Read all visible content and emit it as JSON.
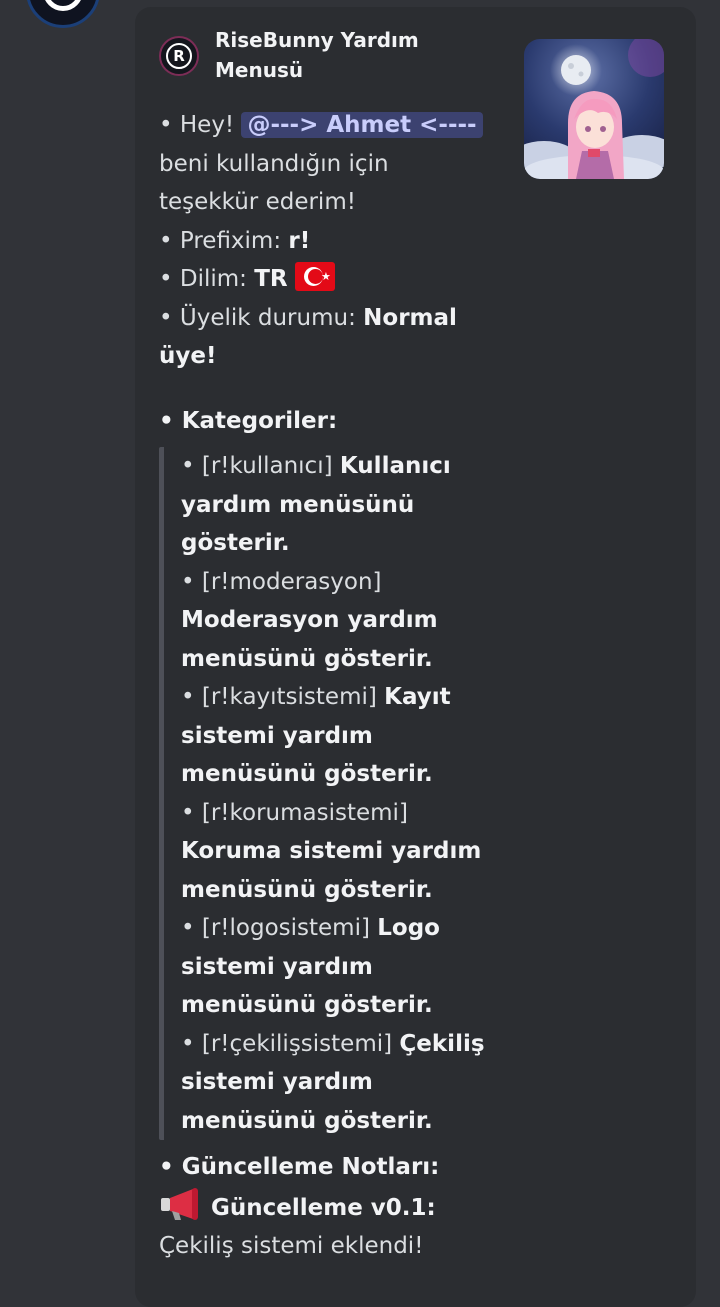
{
  "embed": {
    "author": "RiseBunny  Yardım Menusü",
    "author_icon_letter": "R",
    "intro": {
      "hey": "• Hey! ",
      "mention": "@--->  Ahmet <----",
      "thanks": " beni kullandığın için teşekkür ederim!"
    },
    "prefix": {
      "label": " •  Prefixim: ",
      "value": "r!"
    },
    "language": {
      "label": " • Dilim: ",
      "value": "TR"
    },
    "membership": {
      "label": " • Üyelik durumu: ",
      "value": "Normal üye!"
    },
    "categories_title": "• Kategoriler:",
    "categories": [
      {
        "command": "• [r!kullanıcı] ",
        "description": "Kullanıcı yardım menüsünü gösterir."
      },
      {
        "command": "• [r!moderasyon] ",
        "description": "Moderasyon yardım menüsünü gösterir."
      },
      {
        "command": "• [r!kayıtsistemi] ",
        "description": "Kayıt sistemi yardım menüsünü gösterir."
      },
      {
        "command": "• [r!korumasistemi] ",
        "description": "Koruma sistemi yardım menüsünü gösterir."
      },
      {
        "command": "• [r!logosistemi] ",
        "description": "Logo sistemi yardım menüsünü gösterir."
      },
      {
        "command": "• [r!çekilişsistemi] ",
        "description": "Çekiliş sistemi yardım menüsünü gösterir."
      }
    ],
    "update_title": "• Güncelleme Notları:",
    "update_version": " Güncelleme v0.1:",
    "update_note": "Çekiliş sistemi eklendi!"
  },
  "icons": {
    "top_avatar": "bot-avatar-icon",
    "author_icon": "registered-r-icon",
    "thumbnail": "anime-girl-moon-thumbnail",
    "flag": "turkey-flag-icon",
    "megaphone": "megaphone-icon"
  },
  "colors": {
    "background": "#313338",
    "embed_background": "#2b2d31",
    "mention_background": "#3c4270",
    "mention_text": "#c9cdfb"
  }
}
